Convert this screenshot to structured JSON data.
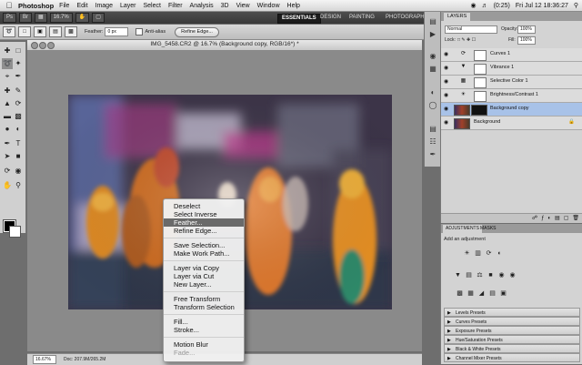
{
  "menubar": {
    "apple": "",
    "app": "Photoshop",
    "items": [
      "File",
      "Edit",
      "Image",
      "Layer",
      "Select",
      "Filter",
      "Analysis",
      "3D",
      "View",
      "Window",
      "Help"
    ],
    "battery": "(0:25)",
    "clock": "Fri Jul 12  18:36:27"
  },
  "appbar": {
    "zoom": "16.7%",
    "workspaces": {
      "essentials": "ESSENTIALS",
      "design": "DESIGN",
      "painting": "PAINTING",
      "photography": "PHOTOGRAPH"
    }
  },
  "options": {
    "feather_label": "Feather:",
    "feather_value": "0 px",
    "antialias_label": "Anti-alias",
    "style_label": "Style:",
    "refine_edge": "Refine Edge..."
  },
  "document": {
    "title": "IMG_5458.CR2 @ 16.7% (Background copy, RGB/16*) *",
    "zoom": "16.67%",
    "info": "Doc: 207.9M/265.2M"
  },
  "context_menu": {
    "items": [
      "Deselect",
      "Select Inverse",
      "Feather...",
      "Refine Edge...",
      "Save Selection...",
      "Make Work Path...",
      "Layer via Copy",
      "Layer via Cut",
      "New Layer...",
      "Free Transform",
      "Transform Selection",
      "Fill...",
      "Stroke...",
      "Motion Blur",
      "Fade..."
    ],
    "highlighted": "Feather...",
    "disabled": [
      "Fade..."
    ]
  },
  "layers_panel": {
    "tab": "LAYERS",
    "blend_mode": "Normal",
    "opacity_label": "Opacity:",
    "opacity": "100%",
    "lock_label": "Lock:",
    "fill_label": "Fill:",
    "fill": "100%",
    "layers": [
      {
        "name": "Curves 1",
        "selected": false
      },
      {
        "name": "Vibrance 1",
        "selected": false
      },
      {
        "name": "Selective Color 1",
        "selected": false
      },
      {
        "name": "Brightness/Contrast 1",
        "selected": false
      },
      {
        "name": "Background copy",
        "selected": true
      },
      {
        "name": "Background",
        "selected": false
      }
    ]
  },
  "adjustments_panel": {
    "tabs": [
      "ADJUSTMENTS",
      "MASKS"
    ],
    "title": "Add an adjustment",
    "presets": [
      "Levels Presets",
      "Curves Presets",
      "Exposure Presets",
      "Hue/Saturation Presets",
      "Black & White Presets",
      "Channel Mixer Presets"
    ]
  },
  "colors": {
    "foreground": "#000000",
    "background": "#ffffff",
    "selected_layer": "#a8c2e8"
  }
}
